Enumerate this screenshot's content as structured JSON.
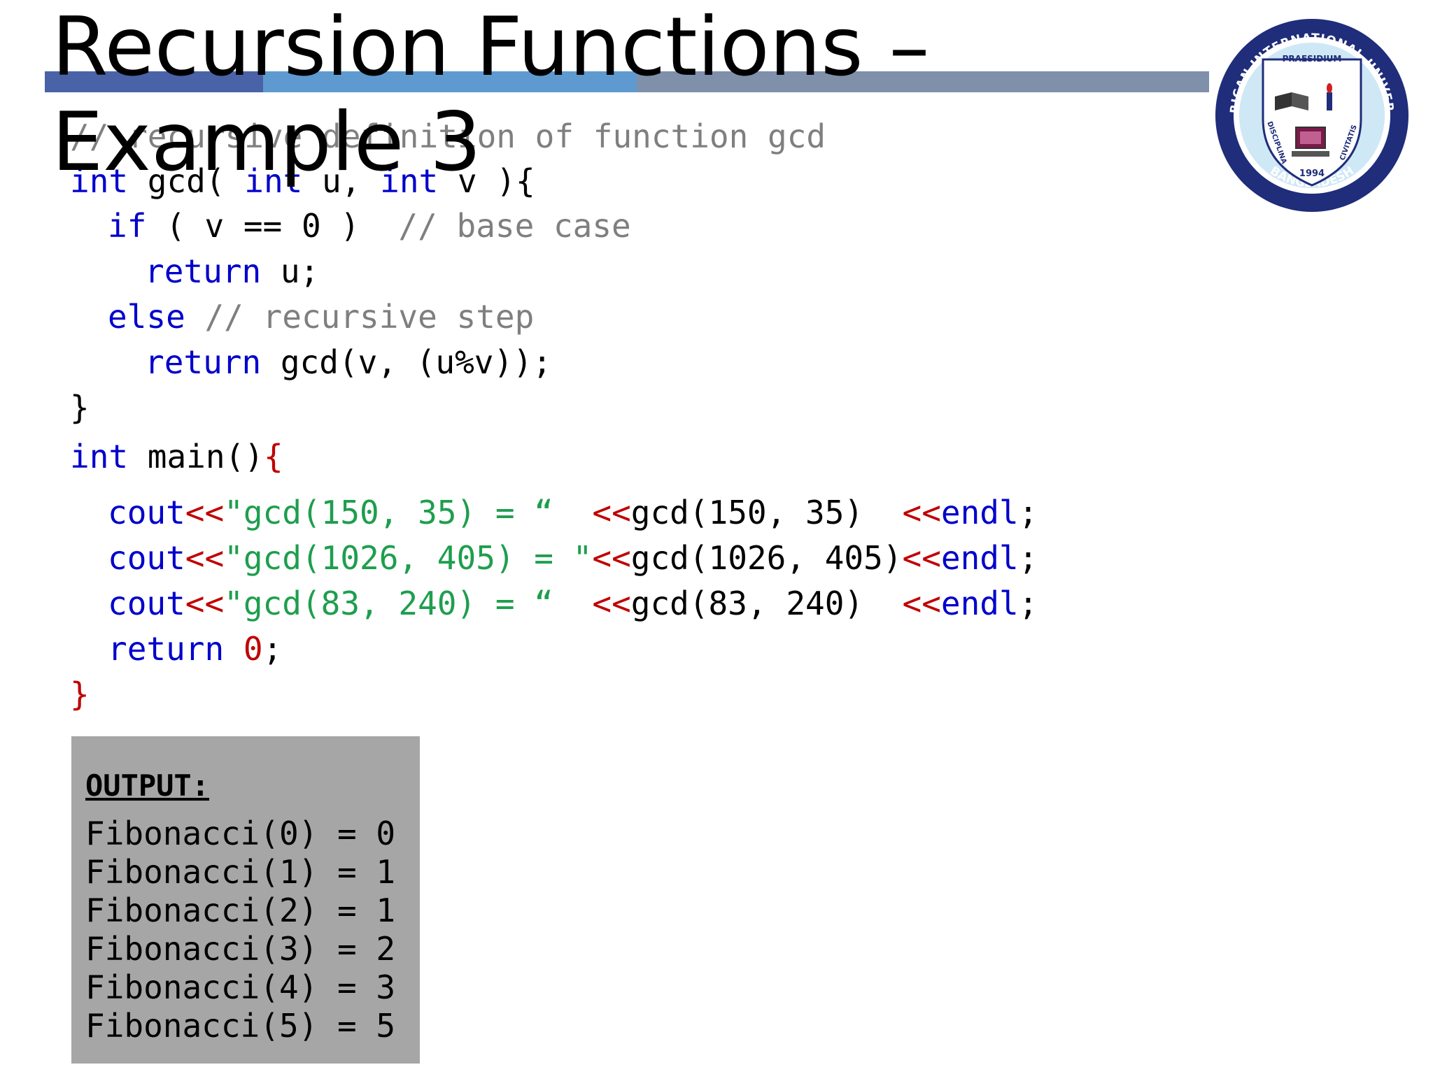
{
  "slide": {
    "title": "Recursion Functions – Example 3"
  },
  "code": {
    "line1": "// recursive definition of function gcd",
    "line2": {
      "kw1": "int",
      "t1": " gcd( ",
      "kw2": "int",
      "t2": " u, ",
      "kw3": "int",
      "t3": " v ){"
    },
    "line3": {
      "kw": "if",
      "t": " ( v == 0 )  ",
      "cm": "// base case"
    },
    "line4": {
      "kw": "return",
      "t": " u;"
    },
    "line5": {
      "kw": "else",
      "cm": " // recursive step"
    },
    "line6": {
      "kw": "return",
      "t": " gcd(v, (u%v));"
    },
    "line7": "}",
    "line8": {
      "kw": "int",
      "t": " main()",
      "brace": "{"
    },
    "cout1": {
      "cout": "cout",
      "op1": "<<",
      "str": "\"gcd(150, 35) = “  ",
      "op2": "<<",
      "call": "gcd(150, 35)  ",
      "op3": "<<",
      "endl": "endl",
      "semi": ";"
    },
    "cout2": {
      "cout": "cout",
      "op1": "<<",
      "str": "\"gcd(1026, 405) = \"",
      "op2": "<<",
      "call": "gcd(1026, 405)",
      "op3": "<<",
      "endl": "endl",
      "semi": ";"
    },
    "cout3": {
      "cout": "cout",
      "op1": "<<",
      "str": "\"gcd(83, 240) = “  ",
      "op2": "<<",
      "call": "gcd(83, 240)  ",
      "op3": "<<",
      "endl": "endl",
      "semi": ";"
    },
    "ret": {
      "kw": "return",
      "num": "0",
      "semi": ";"
    },
    "close": "}"
  },
  "output": {
    "title": "OUTPUT:",
    "lines": [
      "Fibonacci(0) = 0",
      "Fibonacci(1) = 1",
      "Fibonacci(2) = 1",
      "Fibonacci(3) = 2",
      "Fibonacci(4) = 3",
      "Fibonacci(5) = 5"
    ]
  },
  "logo": {
    "ring_text": "AMERICAN INTERNATIONAL UNIVERSITY",
    "bottom_text": "BANGLADESH",
    "motto_top": "PRAESIDIUM",
    "motto_left": "DISCIPLINA",
    "motto_right": "CIVITATIS",
    "year": "1994",
    "colors": {
      "ring": "#1f2d7a",
      "shield": "#ffffff",
      "accent": "#d02020",
      "gold": "#d4a017"
    }
  }
}
